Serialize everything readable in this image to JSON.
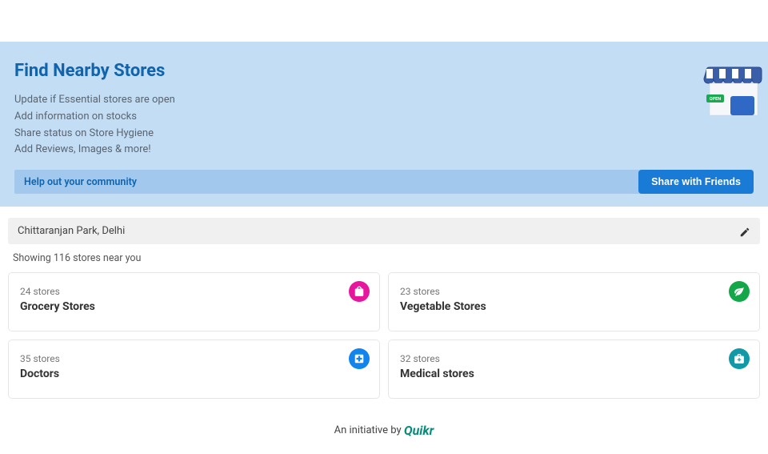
{
  "hero": {
    "title": "Find Nearby Stores",
    "features": [
      "Update if Essential stores are open",
      "Add information on stocks",
      "Share status on Store Hygiene",
      "Add Reviews, Images & more!"
    ]
  },
  "help_bar": {
    "text": "Help out your community",
    "button": "Share with Friends"
  },
  "location": {
    "value": "Chittaranjan Park, Delhi"
  },
  "results": {
    "summary": "Showing 116 stores near you"
  },
  "categories": [
    {
      "count": "24 stores",
      "name": "Grocery Stores",
      "icon_class": "icon-pink",
      "icon": "shopping-bag"
    },
    {
      "count": "23 stores",
      "name": "Vegetable Stores",
      "icon_class": "icon-green",
      "icon": "leaf"
    },
    {
      "count": "35 stores",
      "name": "Doctors",
      "icon_class": "icon-blue",
      "icon": "medical-cross"
    },
    {
      "count": "32 stores",
      "name": "Medical stores",
      "icon_class": "icon-teal",
      "icon": "medical-bag"
    }
  ],
  "footer": {
    "prefix": "An initiative by",
    "brand": "Quikr"
  }
}
